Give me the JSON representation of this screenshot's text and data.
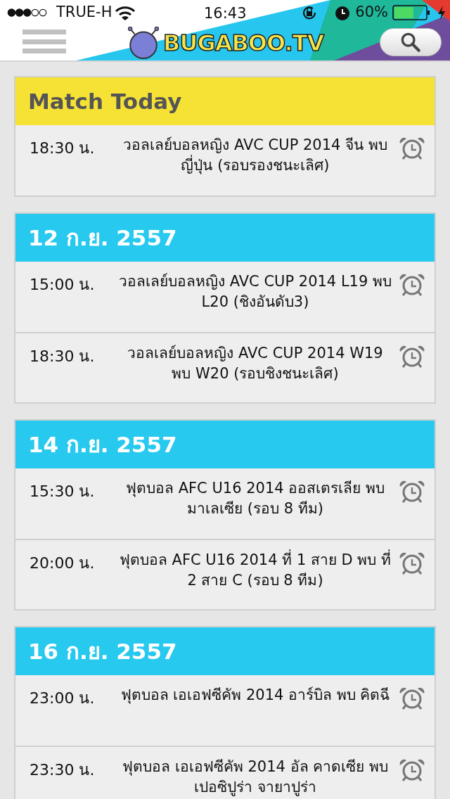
{
  "status_bar": {
    "carrier": "TRUE-H",
    "time": "16:43",
    "battery": "60%"
  },
  "header": {
    "logo": "BUGABOO.TV"
  },
  "sections": [
    {
      "kind": "today",
      "title": "Match Today",
      "matches": [
        {
          "time": "18:30 น.",
          "title": "วอลเลย์บอลหญิง AVC CUP 2014 จีน พบ ญี่ปุ่น (รอบรองชนะเลิศ)"
        }
      ]
    },
    {
      "kind": "date",
      "title": "12 ก.ย. 2557",
      "matches": [
        {
          "time": "15:00 น.",
          "title": "วอลเลย์บอลหญิง AVC CUP 2014 L19 พบ L20 (ชิงอันดับ3)"
        },
        {
          "time": "18:30 น.",
          "title": "วอลเลย์บอลหญิง AVC CUP 2014 W19 พบ W20 (รอบชิงชนะเลิศ)"
        }
      ]
    },
    {
      "kind": "date",
      "title": "14 ก.ย. 2557",
      "matches": [
        {
          "time": "15:30 น.",
          "title": "ฟุตบอล AFC U16 2014 ออสเตรเลีย พบ มาเลเซีย (รอบ 8 ทีม)"
        },
        {
          "time": "20:00 น.",
          "title": "ฟุตบอล AFC U16 2014 ที่ 1 สาย D พบ ที่ 2 สาย C (รอบ 8 ทีม)"
        }
      ]
    },
    {
      "kind": "date",
      "title": "16 ก.ย. 2557",
      "matches": [
        {
          "time": "23:00 น.",
          "title": "ฟุตบอล เอเอฟซีคัพ 2014 อาร์บิล พบ คิตฉี"
        },
        {
          "time": "23:30 น.",
          "title": "ฟุตบอล เอเอฟซีคัพ 2014 อัล คาดเซีย พบ เปอซิปูร่า จายาปูร่า"
        }
      ]
    }
  ]
}
